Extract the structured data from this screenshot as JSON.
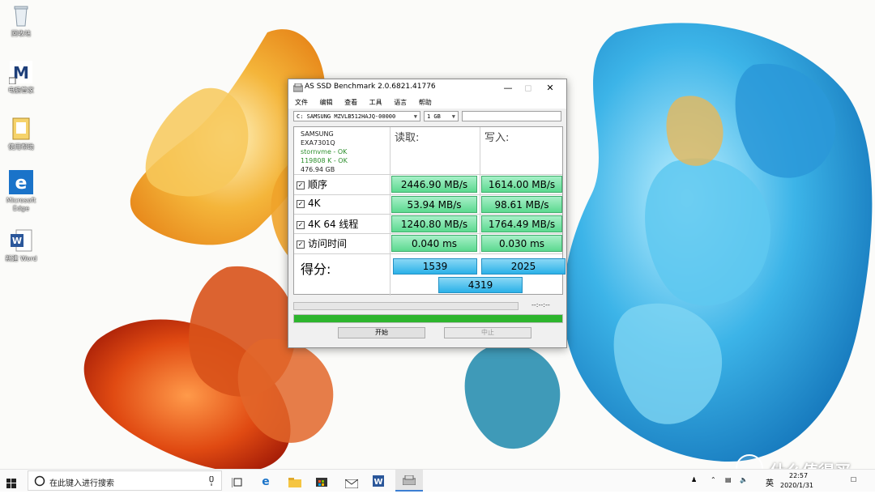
{
  "desktop": {
    "icons": [
      {
        "label": "回收站",
        "icon": "recycle-bin-icon"
      },
      {
        "label": "电脑管家",
        "icon": "pc-manager-icon"
      },
      {
        "label": "使用帮助",
        "icon": "help-icon"
      },
      {
        "label": "Microsoft Edge",
        "icon": "edge-icon"
      },
      {
        "label": "新建 Word",
        "icon": "word-icon"
      }
    ]
  },
  "window": {
    "title": "AS SSD Benchmark 2.0.6821.41776",
    "menu": [
      "文件",
      "编辑",
      "查看",
      "工具",
      "语言",
      "帮助"
    ],
    "drive_select": "C: SAMSUNG MZVLB512HAJQ-00000",
    "size_select": "1 GB",
    "drive_info": {
      "vendor": "SAMSUNG",
      "model": "EXA7301Q",
      "driver": "stornvme - OK",
      "alignment": "119808 K - OK",
      "capacity": "476.94 GB"
    },
    "col_read": "读取:",
    "col_write": "写入:",
    "rows": [
      {
        "label": "顺序",
        "read": "2446.90 MB/s",
        "write": "1614.00 MB/s"
      },
      {
        "label": "4K",
        "read": "53.94 MB/s",
        "write": "98.61 MB/s"
      },
      {
        "label": "4K 64 线程",
        "read": "1240.80 MB/s",
        "write": "1764.49 MB/s"
      },
      {
        "label": "访问时间",
        "read": "0.040 ms",
        "write": "0.030 ms"
      }
    ],
    "score_label": "得分:",
    "score_read": "1539",
    "score_write": "2025",
    "score_total": "4319",
    "time_text": "--:--:--",
    "progress": 1.0,
    "start_button": "开始",
    "stop_button": "中止",
    "progress_color": "#2db52d"
  },
  "taskbar": {
    "search_placeholder": "在此键入进行搜索",
    "ime": "英",
    "time": "22:57",
    "date": "2020/1/31"
  },
  "watermark": "什么值得买"
}
